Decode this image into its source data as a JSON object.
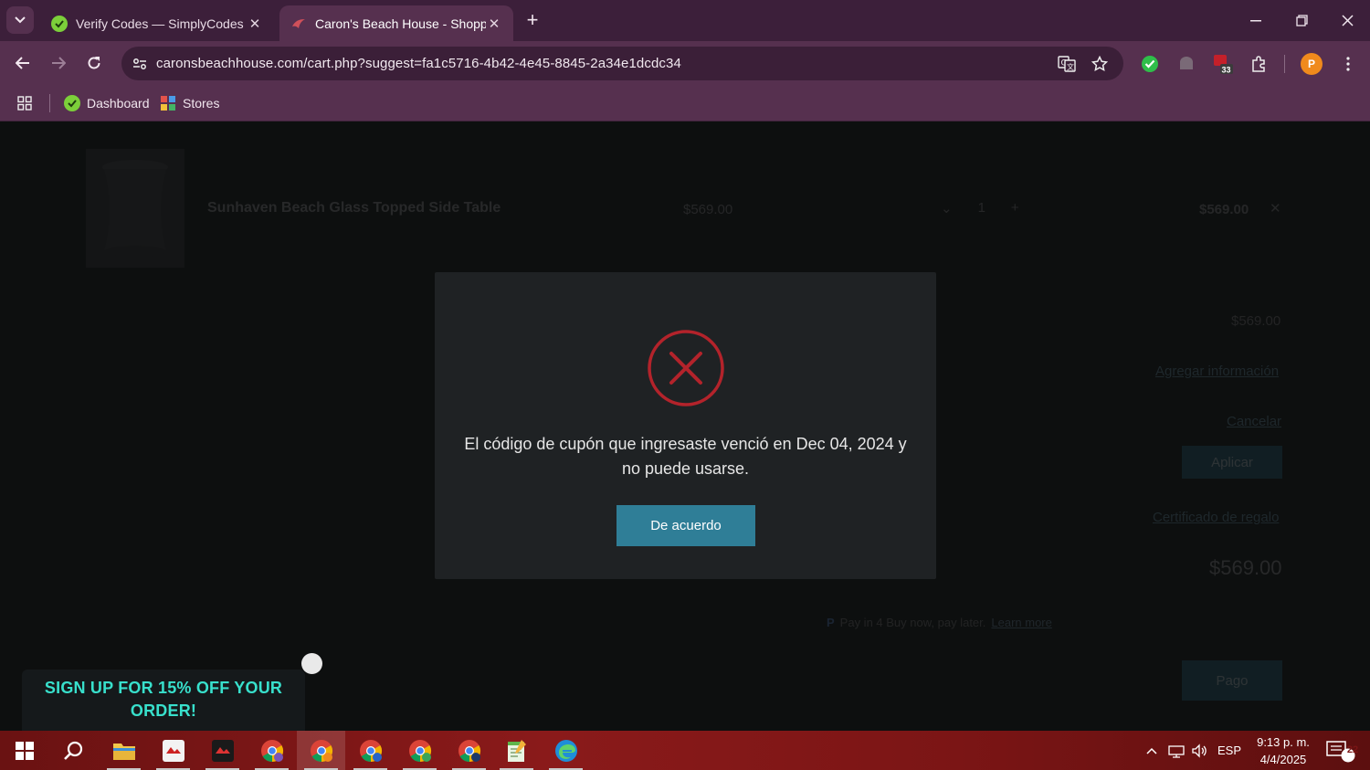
{
  "browser": {
    "tabs": [
      {
        "title": "Verify Codes — SimplyCodes",
        "active": false
      },
      {
        "title": "Caron's Beach House - Shopping Cart",
        "active": true
      }
    ],
    "url": "caronsbeachhouse.com/cart.php?suggest=fa1c5716-4b42-4e45-8845-2a34e1dcdc34",
    "extension_badge": "33",
    "profile_initial": "P",
    "bookmarks": [
      "Dashboard",
      "Stores"
    ],
    "colors": {
      "frame": "#3c1f3a",
      "toolbar": "#56304f"
    }
  },
  "cart": {
    "item": {
      "name": "Sunhaven Beach Glass Topped Side Table",
      "price": "$569.00",
      "quantity": "1",
      "total": "$569.00"
    },
    "summary": {
      "subtotal": "$569.00",
      "add_info_link": "Agregar información",
      "cancel_link": "Cancelar",
      "apply_button": "Aplicar",
      "gift_certificate_link": "Certificado de regalo",
      "grand_total": "$569.00",
      "paypal_text": "Pay in 4 Buy now, pay later.",
      "paypal_link": "Learn more",
      "checkout_button": "Pago"
    }
  },
  "modal": {
    "icon": "error-x-icon",
    "message": "El código de cupón que ingresaste venció en Dec 04, 2024 y no puede usarse.",
    "button": "De acuerdo",
    "accent_color": "#2f7e97",
    "error_color": "#b3232b"
  },
  "promo": {
    "text": "SIGN UP FOR 15% OFF YOUR ORDER!"
  },
  "taskbar": {
    "language": "ESP",
    "time": "9:13 p. m.",
    "date": "4/4/2025",
    "notifications": "22"
  }
}
